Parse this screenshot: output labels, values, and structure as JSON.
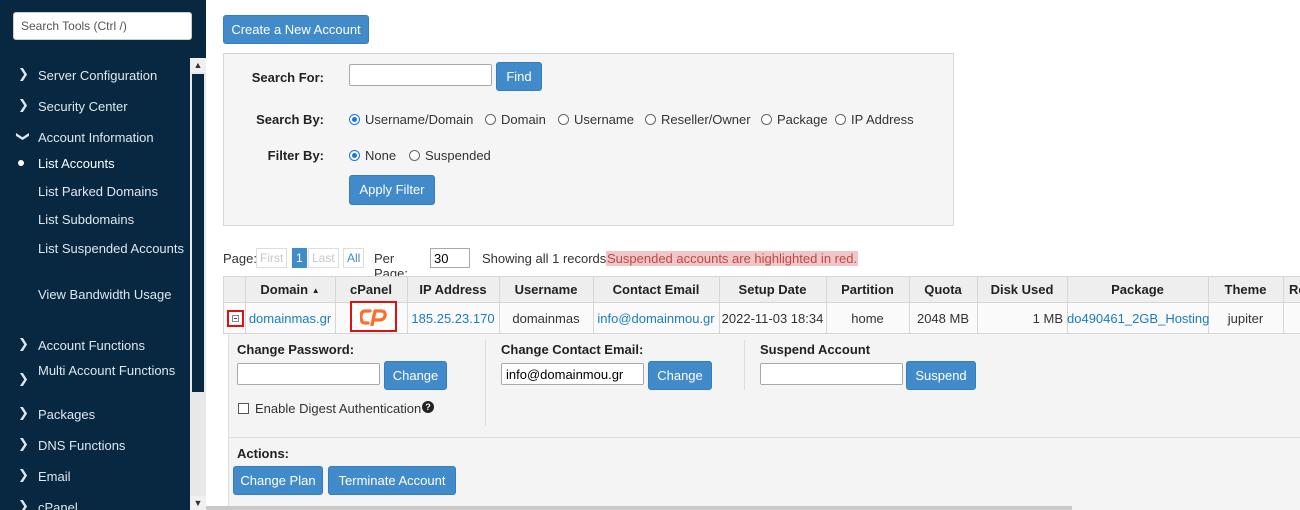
{
  "sidebar": {
    "search_placeholder": "Search Tools (Ctrl /)",
    "items": [
      {
        "label": "Server Configuration",
        "icon": "chevron-right-icon",
        "expanded": false
      },
      {
        "label": "Security Center",
        "icon": "chevron-right-icon",
        "expanded": false
      },
      {
        "label": "Account Information",
        "icon": "chevron-down-icon",
        "expanded": true
      },
      {
        "label": "List Accounts",
        "sub": true,
        "active": true
      },
      {
        "label": "List Parked Domains",
        "sub": true
      },
      {
        "label": "List Subdomains",
        "sub": true
      },
      {
        "label": "List Suspended Accounts",
        "sub": true
      },
      {
        "label": "View Bandwidth Usage",
        "sub": true
      },
      {
        "label": "Account Functions",
        "icon": "chevron-right-icon"
      },
      {
        "label": "Multi Account Functions",
        "icon": "chevron-right-icon"
      },
      {
        "label": "Packages",
        "icon": "chevron-right-icon"
      },
      {
        "label": "DNS Functions",
        "icon": "chevron-right-icon"
      },
      {
        "label": "Email",
        "icon": "chevron-right-icon"
      },
      {
        "label": "cPanel",
        "icon": "chevron-right-icon"
      }
    ]
  },
  "main": {
    "create_button": "Create a New Account",
    "search": {
      "search_for_label": "Search For:",
      "search_value": "",
      "find_button": "Find",
      "search_by_label": "Search By:",
      "search_by_options": [
        "Username/Domain",
        "Domain",
        "Username",
        "Reseller/Owner",
        "Package",
        "IP Address"
      ],
      "search_by_selected": "Username/Domain",
      "filter_by_label": "Filter By:",
      "filter_by_options": [
        "None",
        "Suspended"
      ],
      "filter_by_selected": "None",
      "apply_button": "Apply Filter"
    },
    "pager": {
      "page_label": "Page:",
      "first": "First",
      "current": "1",
      "last": "Last",
      "all": "All",
      "per_page_label": "Per Page:",
      "per_page_value": "30",
      "showing": "Showing all 1 records.",
      "suspended_note": "Suspended accounts are highlighted in red."
    },
    "table": {
      "headers": [
        "Domain",
        "cPanel",
        "IP Address",
        "Username",
        "Contact Email",
        "Setup Date",
        "Partition",
        "Quota",
        "Disk Used",
        "Package",
        "Theme",
        "Re"
      ],
      "sort_indicator": "▲",
      "row": {
        "domain": "domainmas.gr",
        "ip": "185.25.23.170",
        "username": "domainmas",
        "email": "info@domainmou.gr",
        "setup_date": "2022-11-03 18:34",
        "partition": "home",
        "quota": "2048 MB",
        "disk_used": "1 MB",
        "package": "do490461_2GB_Hosting",
        "theme": "jupiter"
      }
    },
    "details": {
      "change_password_label": "Change Password:",
      "password_value": "",
      "change_button": "Change",
      "digest_label": "Enable Digest Authentication",
      "change_email_label": "Change Contact Email:",
      "email_value": "info@domainmou.gr",
      "change_email_button": "Change",
      "suspend_label": "Suspend Account",
      "suspend_value": "",
      "suspend_button": "Suspend",
      "actions_label": "Actions:",
      "change_plan_button": "Change Plan",
      "terminate_button": "Terminate Account"
    }
  },
  "colors": {
    "sidebar_bg": "#072840",
    "primary_button": "#428bca",
    "link": "#1a7cc5",
    "highlight_red": "#dd1111",
    "suspended_note_bg": "#f2c6c6",
    "cpanel_logo": "#ff6c2c"
  }
}
